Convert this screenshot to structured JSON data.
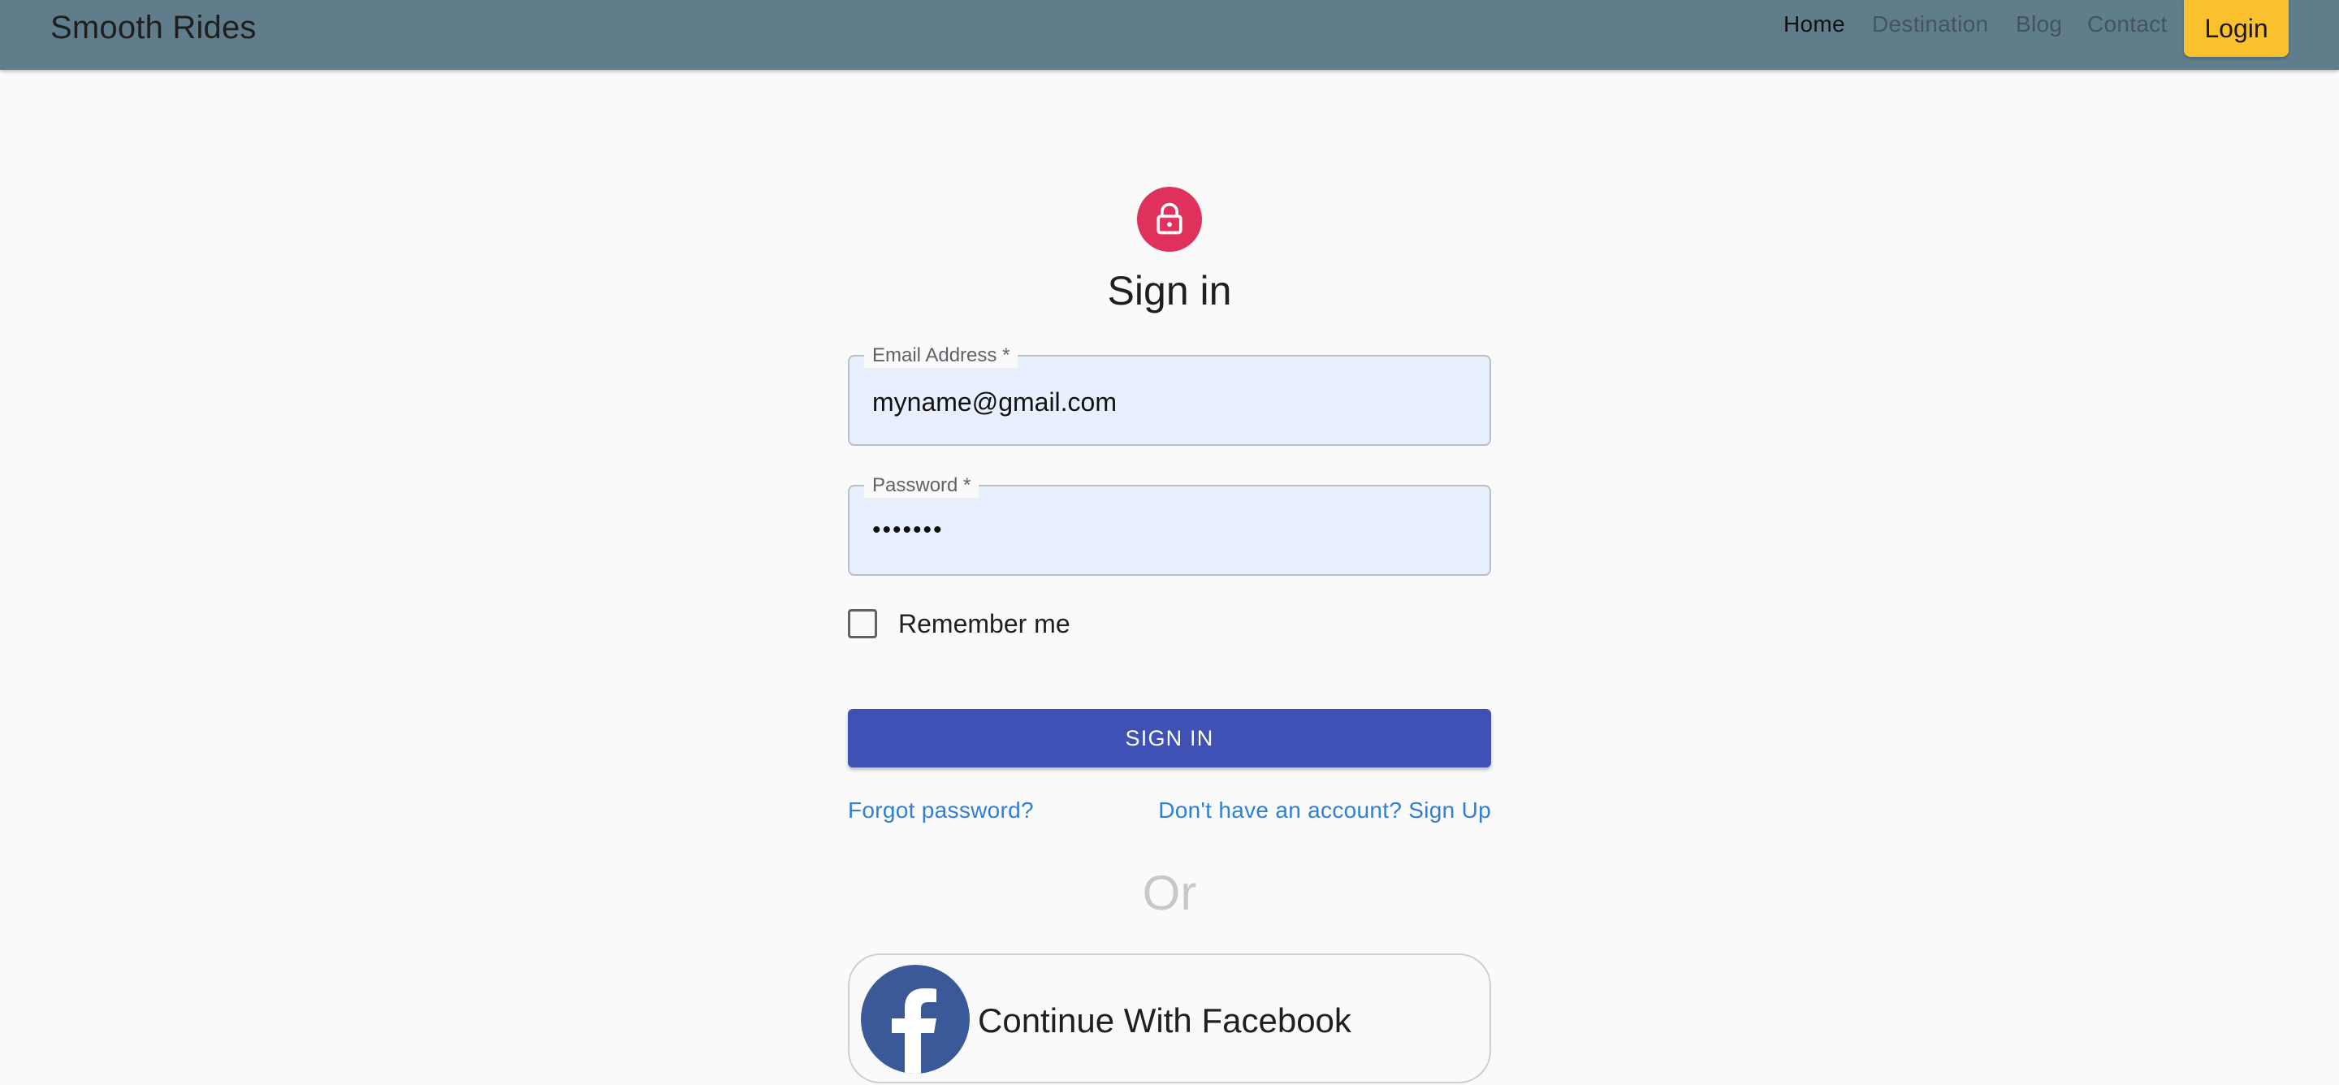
{
  "appbar": {
    "brand": "Smooth Rides",
    "nav": [
      {
        "label": "Home",
        "active": true
      },
      {
        "label": "Destination",
        "active": false
      },
      {
        "label": "Blog",
        "active": false
      },
      {
        "label": "Contact",
        "active": false
      }
    ],
    "login_label": "Login",
    "background_color": "#607d8b",
    "login_color": "#fbc02d"
  },
  "form": {
    "icon": "lock-icon",
    "title": "Sign in",
    "email": {
      "label": "Email Address *",
      "value": "myname@gmail.com"
    },
    "password": {
      "label": "Password *",
      "value": "•••••••"
    },
    "remember_label": "Remember me",
    "remember_checked": false,
    "submit_label": "SIGN IN",
    "forgot_link": "Forgot password?",
    "signup_link": "Don't have an account? Sign Up",
    "divider_text": "Or",
    "facebook_label": "Continue With Facebook",
    "colors": {
      "avatar": "#e0305c",
      "submit": "#3f51b5",
      "link": "#2f7fd8",
      "facebook": "#3b5998"
    }
  }
}
